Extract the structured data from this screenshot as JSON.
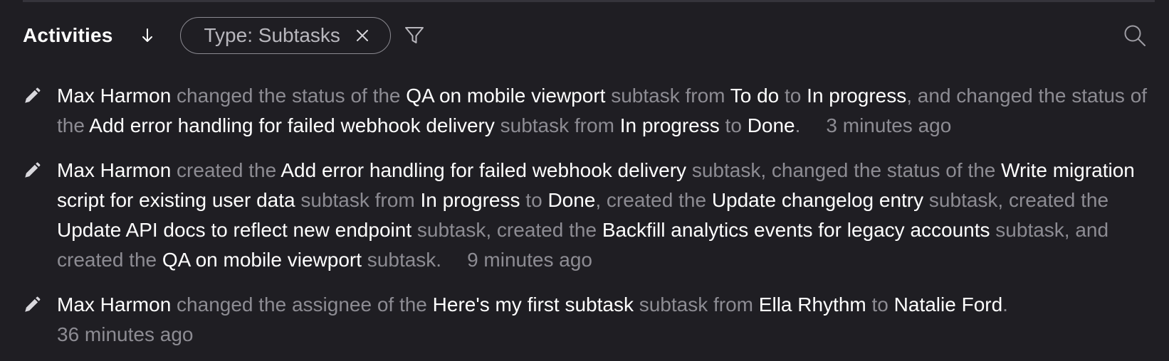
{
  "header": {
    "title": "Activities",
    "filter_chip_label": "Type: Subtasks"
  },
  "activities": [
    {
      "parts": [
        {
          "t": "Max Harmon",
          "h": true
        },
        {
          "t": " changed the status of the ",
          "h": false
        },
        {
          "t": "QA on mobile viewport",
          "h": true
        },
        {
          "t": " subtask from ",
          "h": false
        },
        {
          "t": "To do",
          "h": true
        },
        {
          "t": " to ",
          "h": false
        },
        {
          "t": "In progress",
          "h": true
        },
        {
          "t": ", and changed the status of the ",
          "h": false
        },
        {
          "t": "Add error handling for failed webhook delivery",
          "h": true
        },
        {
          "t": " subtask from ",
          "h": false
        },
        {
          "t": "In progress",
          "h": true
        },
        {
          "t": " to ",
          "h": false
        },
        {
          "t": "Done",
          "h": true
        },
        {
          "t": ".",
          "h": false
        }
      ],
      "time": "3 minutes ago",
      "time_on_new_line": false
    },
    {
      "parts": [
        {
          "t": "Max Harmon",
          "h": true
        },
        {
          "t": " created the ",
          "h": false
        },
        {
          "t": "Add error handling for failed webhook delivery",
          "h": true
        },
        {
          "t": " subtask, changed the status of the ",
          "h": false
        },
        {
          "t": "Write migration script for existing user data",
          "h": true
        },
        {
          "t": " subtask from ",
          "h": false
        },
        {
          "t": "In progress",
          "h": true
        },
        {
          "t": " to ",
          "h": false
        },
        {
          "t": "Done",
          "h": true
        },
        {
          "t": ", created the ",
          "h": false
        },
        {
          "t": "Update changelog entry",
          "h": true
        },
        {
          "t": " subtask, created the ",
          "h": false
        },
        {
          "t": "Update API docs to reflect new endpoint",
          "h": true
        },
        {
          "t": " subtask, created the ",
          "h": false
        },
        {
          "t": "Backfill analytics events for legacy accounts",
          "h": true
        },
        {
          "t": " subtask, and created the ",
          "h": false
        },
        {
          "t": "QA on mobile viewport",
          "h": true
        },
        {
          "t": " subtask.",
          "h": false
        }
      ],
      "time": "9 minutes ago",
      "time_on_new_line": false
    },
    {
      "parts": [
        {
          "t": "Max Harmon",
          "h": true
        },
        {
          "t": " changed the assignee of the ",
          "h": false
        },
        {
          "t": "Here's my first subtask",
          "h": true
        },
        {
          "t": " subtask from ",
          "h": false
        },
        {
          "t": "Ella Rhythm",
          "h": true
        },
        {
          "t": " to ",
          "h": false
        },
        {
          "t": "Natalie Ford",
          "h": true
        },
        {
          "t": ".",
          "h": false
        }
      ],
      "time": "36 minutes ago",
      "time_on_new_line": true
    }
  ],
  "icons": {
    "sort": "arrow-down-icon",
    "chip_close": "close-icon",
    "filter": "filter-icon",
    "search": "search-icon",
    "entry": "pencil-icon"
  },
  "colors": {
    "background": "#1f1e23",
    "highlight_text": "#ffffff",
    "muted_text": "#8d8c93",
    "chip_border": "#8b8a91"
  }
}
